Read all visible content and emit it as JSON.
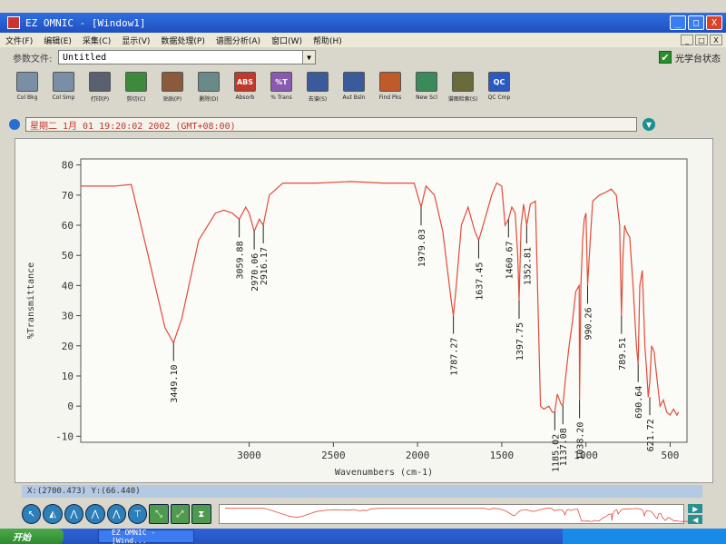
{
  "window": {
    "title": "EZ OMNIC - [Window1]",
    "controls": [
      "_",
      "□",
      "X"
    ]
  },
  "menu": {
    "items": [
      "文件(F)",
      "编辑(E)",
      "采集(C)",
      "显示(V)",
      "数据处理(P)",
      "谱图分析(A)",
      "窗口(W)",
      "帮助(H)"
    ],
    "mdi_controls": [
      "_",
      "□",
      "X"
    ]
  },
  "params": {
    "label": "参数文件:",
    "value": "Untitled",
    "option_label": "光学台状态"
  },
  "toolbar": [
    {
      "label": "Col Bkg",
      "color": "#7a8fa6"
    },
    {
      "label": "Col Smp",
      "color": "#7a8fa6"
    },
    {
      "label": "打印(P)",
      "color": "#5a6070"
    },
    {
      "label": "剪切(C)",
      "color": "#3c8a3c"
    },
    {
      "label": "贴贴(P)",
      "color": "#8a5a3c"
    },
    {
      "label": "删除(D)",
      "color": "#6a8a8a"
    },
    {
      "label": "Absorb",
      "color": "#c0392b",
      "icon": "ABS"
    },
    {
      "label": "% Trans",
      "color": "#8a5ab0",
      "icon": "%T"
    },
    {
      "label": "去谱(S)",
      "color": "#3a5a9a"
    },
    {
      "label": "Aut Bsln",
      "color": "#3a5a9a"
    },
    {
      "label": "Find Pks",
      "color": "#c05a2b"
    },
    {
      "label": "New Scl",
      "color": "#3a8a5a"
    },
    {
      "label": "谱图检索(S)",
      "color": "#6a6a3a"
    },
    {
      "label": "QC Cmp",
      "color": "#2a5abf",
      "icon": "QC"
    }
  ],
  "collection": {
    "date": "星期二 1月 01 19:20:02 2002 (GMT+08:00)"
  },
  "status": {
    "cursor": "X:(2700.473) Y:(66.440)"
  },
  "taskbar": {
    "start": "开始",
    "task": "EZ OMNIC - [Wind..."
  },
  "chart_data": {
    "type": "line",
    "ylabel": "%Transmittance",
    "xlabel": "Wavenumbers (cm-1)",
    "xlim": [
      4000,
      400
    ],
    "ylim": [
      -12,
      82
    ],
    "xticks": [
      3000,
      2500,
      2000,
      1500,
      1000,
      500
    ],
    "yticks": [
      80,
      70,
      60,
      50,
      40,
      30,
      20,
      10,
      0,
      -10
    ],
    "series": [
      {
        "color": "#e24b3b",
        "x": [
          4000,
          3800,
          3700,
          3600,
          3500,
          3449,
          3400,
          3300,
          3200,
          3150,
          3100,
          3059,
          3020,
          3000,
          2970,
          2940,
          2916,
          2880,
          2800,
          2600,
          2400,
          2200,
          2020,
          1979,
          1950,
          1900,
          1850,
          1800,
          1787,
          1770,
          1740,
          1700,
          1680,
          1660,
          1637,
          1600,
          1560,
          1530,
          1500,
          1480,
          1460,
          1440,
          1420,
          1405,
          1397,
          1385,
          1370,
          1352,
          1330,
          1300,
          1270,
          1250,
          1220,
          1200,
          1185,
          1170,
          1150,
          1137,
          1120,
          1100,
          1080,
          1060,
          1040,
          1038,
          1030,
          1020,
          1010,
          1000,
          990,
          980,
          960,
          920,
          880,
          850,
          820,
          800,
          789,
          780,
          770,
          760,
          740,
          720,
          700,
          690,
          680,
          665,
          650,
          640,
          630,
          621,
          610,
          595,
          580,
          560,
          540,
          520,
          500,
          480,
          460,
          450
        ],
        "y": [
          73,
          73,
          73.5,
          50,
          26,
          21,
          29,
          55,
          64,
          65,
          64,
          62,
          66,
          64,
          58,
          62,
          60,
          70,
          74,
          74,
          74.5,
          74,
          74,
          66,
          73,
          70,
          58,
          35,
          30,
          40,
          60,
          66,
          62,
          58,
          55,
          62,
          70,
          74,
          73,
          60,
          62,
          66,
          64,
          50,
          35,
          60,
          67,
          60,
          67,
          68,
          0,
          -1,
          0,
          -2,
          -2,
          4,
          1,
          0,
          10,
          20,
          28,
          38,
          40,
          2,
          40,
          55,
          62,
          64,
          40,
          50,
          68,
          70,
          71,
          72,
          70,
          60,
          30,
          50,
          60,
          58,
          56,
          40,
          20,
          14,
          40,
          45,
          20,
          12,
          3,
          8,
          20,
          18,
          10,
          0,
          2,
          -2,
          -3,
          -1,
          -3,
          -2
        ]
      }
    ],
    "peaks": [
      {
        "label": "3449.10",
        "x": 3449,
        "y": 21
      },
      {
        "label": "3059.88",
        "x": 3059,
        "y": 62
      },
      {
        "label": "2970.06",
        "x": 2970,
        "y": 58
      },
      {
        "label": "2916.17",
        "x": 2916,
        "y": 60
      },
      {
        "label": "1979.03",
        "x": 1979,
        "y": 66
      },
      {
        "label": "1787.27",
        "x": 1787,
        "y": 30
      },
      {
        "label": "1637.45",
        "x": 1637,
        "y": 55
      },
      {
        "label": "1460.67",
        "x": 1460,
        "y": 62
      },
      {
        "label": "1397.75",
        "x": 1397,
        "y": 35
      },
      {
        "label": "1352.81",
        "x": 1352,
        "y": 60
      },
      {
        "label": "1185.02",
        "x": 1185,
        "y": -2
      },
      {
        "label": "1137.08",
        "x": 1137,
        "y": 0
      },
      {
        "label": "1038.20",
        "x": 1038,
        "y": 2
      },
      {
        "label": "990.26",
        "x": 990,
        "y": 40
      },
      {
        "label": "789.51",
        "x": 789,
        "y": 30
      },
      {
        "label": "690.64",
        "x": 690,
        "y": 14
      },
      {
        "label": "621.72",
        "x": 621,
        "y": 3
      }
    ]
  }
}
